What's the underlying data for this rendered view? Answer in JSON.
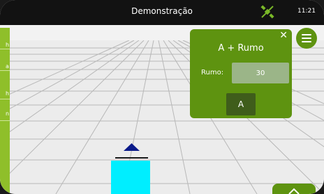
{
  "status_bar": {
    "title": "Demonstração",
    "time": "11:21",
    "icon": "satellite-off-icon"
  },
  "dialog": {
    "title": "A + Rumo",
    "rumo_label": "Rumo:",
    "rumo_value": "30",
    "button_label": "A",
    "close_icon": "close-icon"
  },
  "side_panel": {
    "items": [
      {
        "label": "h"
      },
      {
        "label": "a"
      },
      {
        "label": "h"
      },
      {
        "label": "n"
      }
    ]
  },
  "colors": {
    "accent": "#5e9310",
    "side_panel": "#8fbf2a",
    "implement": "#00eeff",
    "direction_marker": "#0a1a8a"
  }
}
